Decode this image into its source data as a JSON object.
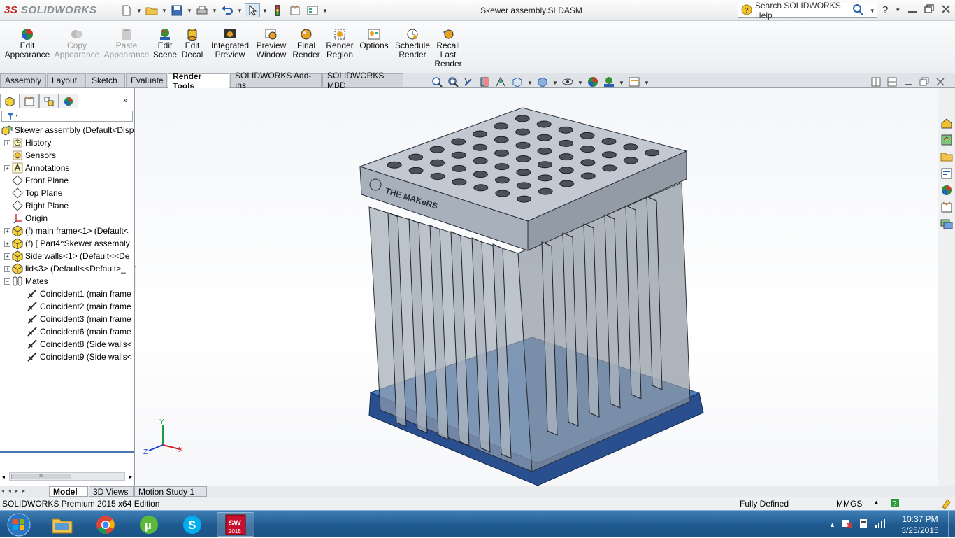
{
  "app": {
    "logo_brand": "3S",
    "logo_text": "SOLIDWORKS",
    "doc_title": "Skewer assembly.SLDASM"
  },
  "search": {
    "placeholder": "Search SOLIDWORKS Help"
  },
  "ribbon": {
    "buttons": [
      {
        "line1": "Edit",
        "line2": "Appearance",
        "line3": "",
        "enabled": true
      },
      {
        "line1": "Copy",
        "line2": "Appearance",
        "line3": "",
        "enabled": false
      },
      {
        "line1": "Paste",
        "line2": "Appearance",
        "line3": "",
        "enabled": false
      },
      {
        "line1": "Edit",
        "line2": "Scene",
        "line3": "",
        "enabled": true
      },
      {
        "line1": "Edit",
        "line2": "Decal",
        "line3": "",
        "enabled": true
      },
      {
        "line1": "Integrated",
        "line2": "Preview",
        "line3": "",
        "enabled": true
      },
      {
        "line1": "Preview",
        "line2": "Window",
        "line3": "",
        "enabled": true
      },
      {
        "line1": "Final",
        "line2": "Render",
        "line3": "",
        "enabled": true
      },
      {
        "line1": "Render",
        "line2": "Region",
        "line3": "",
        "enabled": true
      },
      {
        "line1": "Options",
        "line2": "",
        "line3": "",
        "enabled": true
      },
      {
        "line1": "Schedule",
        "line2": "Render",
        "line3": "",
        "enabled": true
      },
      {
        "line1": "Recall",
        "line2": "Last",
        "line3": "Render",
        "enabled": true
      }
    ]
  },
  "tabs": [
    "Assembly",
    "Layout",
    "Sketch",
    "Evaluate",
    "Render Tools",
    "SOLIDWORKS Add-Ins",
    "SOLIDWORKS MBD"
  ],
  "active_tab": "Render Tools",
  "tree": {
    "root": "Skewer assembly  (Default<Disp",
    "items": [
      {
        "label": "History",
        "icon": "history-icon"
      },
      {
        "label": "Sensors",
        "icon": "sensor-icon"
      },
      {
        "label": "Annotations",
        "icon": "annotation-icon"
      },
      {
        "label": "Front Plane",
        "icon": "plane-icon"
      },
      {
        "label": "Top Plane",
        "icon": "plane-icon"
      },
      {
        "label": "Right Plane",
        "icon": "plane-icon"
      },
      {
        "label": "Origin",
        "icon": "origin-icon"
      },
      {
        "label": "(f) main frame<1> (Default<",
        "icon": "part-icon"
      },
      {
        "label": "(f) [ Part4^Skewer assembly",
        "icon": "part-icon"
      },
      {
        "label": "Side walls<1> (Default<<De",
        "icon": "part-icon"
      },
      {
        "label": "lid<3> (Default<<Default>_",
        "icon": "part-icon"
      },
      {
        "label": "Mates",
        "icon": "mates-icon"
      }
    ],
    "mates": [
      "Coincident1 (main frame",
      "Coincident2 (main frame",
      "Coincident3 (main frame",
      "Coincident6 (main frame",
      "Coincident8 (Side walls<",
      "Coincident9 (Side walls<"
    ]
  },
  "scroll": {
    "thumb_label": "III"
  },
  "model": {
    "decal_text": "THE MAKeRS",
    "triad_x": "X",
    "triad_y": "Y",
    "triad_z": "Z"
  },
  "bottom_tabs": [
    "Model",
    "3D Views",
    "Motion Study 1"
  ],
  "status": {
    "edition": "SOLIDWORKS Premium 2015 x64 Edition",
    "state": "Fully Defined",
    "units": "MMGS"
  },
  "taskbar": {
    "time": "10:37 PM",
    "date": "3/25/2015",
    "sw_label": "2015"
  },
  "colors": {
    "accent_blue": "#1f4e9a",
    "ribbon_bg": "#eceef1",
    "base_plate": "#23407a",
    "taskbar": "#1f5a8f"
  }
}
